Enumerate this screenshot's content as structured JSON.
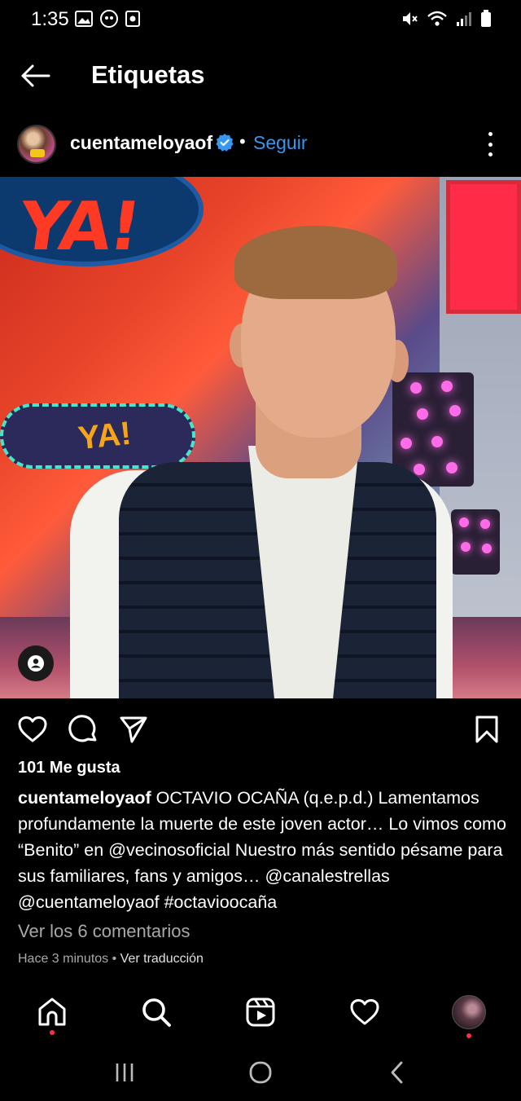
{
  "status_bar": {
    "time": "1:35"
  },
  "header": {
    "title": "Etiquetas"
  },
  "post": {
    "username": "cuentameloyaof",
    "follow_label": "Seguir",
    "separator": "•",
    "likes": "101 Me gusta",
    "caption_username": "cuentameloyaof",
    "caption_text": " OCTAVIO OCAÑA (q.e.p.d.) Lamentamos profundamente la muerte de este joven actor… Lo vimos como “Benito” en @vecinosoficial Nuestro más sentido pésame para sus familiares, fans y amigos… @canalestrellas @cuentameloyaof #octavioocaña",
    "view_comments": "Ver los 6 comentarios",
    "time_ago": "Hace 3 minutos",
    "meta_separator": " • ",
    "translate_label": "Ver traducción"
  },
  "colors": {
    "background": "#000000",
    "link_blue": "#3897f0",
    "secondary_text": "#a8a8a8",
    "notification_dot": "#ff3040"
  },
  "icons": {
    "back": "arrow-left-icon",
    "verified": "verified-badge-icon",
    "more": "more-vertical-icon",
    "like": "heart-icon",
    "comment": "comment-icon",
    "share": "send-icon",
    "save": "bookmark-icon",
    "tag": "user-tag-icon",
    "nav_home": "home-icon",
    "nav_search": "search-icon",
    "nav_reels": "reels-icon",
    "nav_activity": "heart-icon",
    "nav_profile": "profile-avatar"
  }
}
